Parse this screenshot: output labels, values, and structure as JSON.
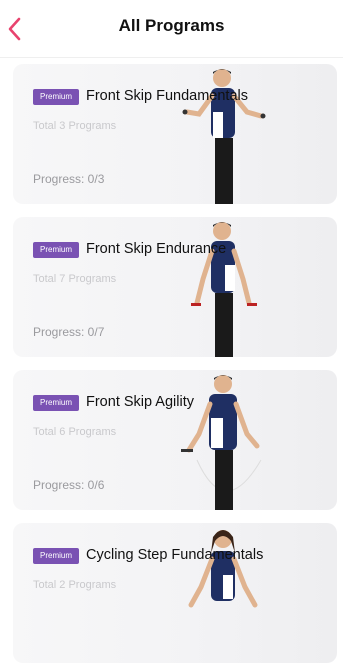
{
  "header": {
    "title": "All Programs",
    "back_icon": "chevron-left-icon",
    "accent": "#e8436e"
  },
  "programs": [
    {
      "badge": "Premium",
      "title": "Front Skip Fundamentals",
      "count": "Total 3 Programs",
      "progress": "Progress: 0/3",
      "figure": "male"
    },
    {
      "badge": "Premium",
      "title": "Front Skip Endurance",
      "count": "Total 7 Programs",
      "progress": "Progress: 0/7",
      "figure": "male"
    },
    {
      "badge": "Premium",
      "title": "Front Skip Agility",
      "count": "Total 6 Programs",
      "progress": "Progress: 0/6",
      "figure": "male"
    },
    {
      "badge": "Premium",
      "title": "Cycling Step Fundamentals",
      "count": "Total 2 Programs",
      "progress": "",
      "figure": "female"
    }
  ],
  "colors": {
    "badge": "#7a52b3",
    "navy": "#1f2f63"
  }
}
